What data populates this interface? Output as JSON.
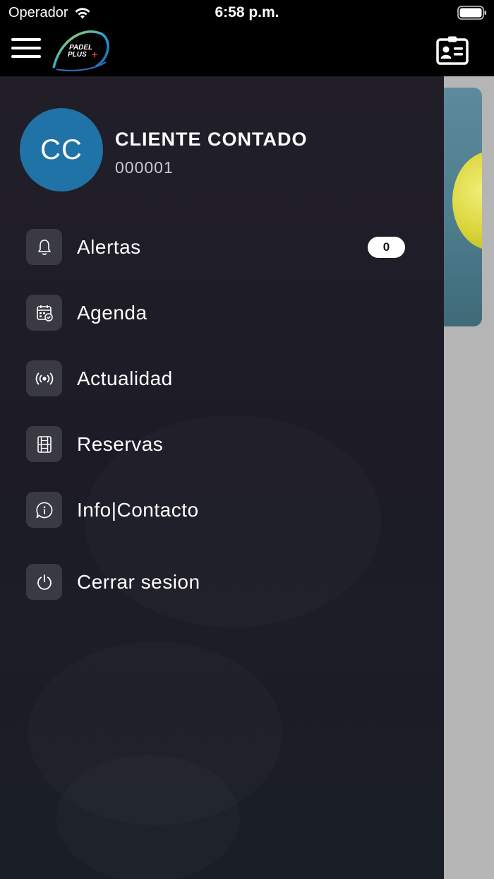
{
  "status_bar": {
    "carrier": "Operador",
    "time": "6:58 p.m."
  },
  "app_bar": {
    "logo_text_line1": "PADEL",
    "logo_text_line2": "PLUS"
  },
  "user": {
    "initials": "CC",
    "name": "CLIENTE CONTADO",
    "code": "000001",
    "avatar_color": "#1f73a6"
  },
  "menu": [
    {
      "label": "Alertas",
      "icon": "bell-icon",
      "badge": "0"
    },
    {
      "label": "Agenda",
      "icon": "calendar-check-icon"
    },
    {
      "label": "Actualidad",
      "icon": "broadcast-icon"
    },
    {
      "label": "Reservas",
      "icon": "court-icon"
    },
    {
      "label": "Info|Contacto",
      "icon": "info-chat-icon"
    },
    {
      "label": "Cerrar sesion",
      "icon": "power-icon"
    }
  ]
}
